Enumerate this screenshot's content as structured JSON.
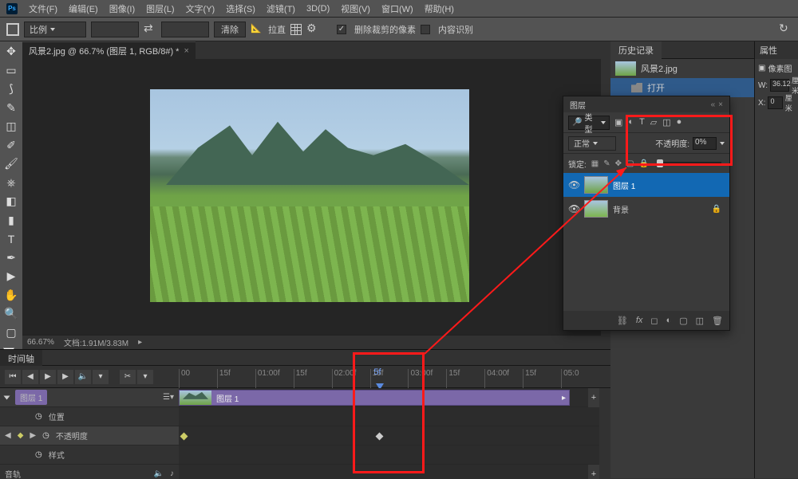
{
  "menubar": {
    "items": [
      "文件(F)",
      "编辑(E)",
      "图像(I)",
      "图层(L)",
      "文字(Y)",
      "选择(S)",
      "滤镜(T)",
      "3D(D)",
      "视图(V)",
      "窗口(W)",
      "帮助(H)"
    ]
  },
  "optbar": {
    "ratio_label": "比例",
    "clear": "清除",
    "straighten": "拉直",
    "delete_cropped": "删除裁剪的像素",
    "content_aware": "内容识别"
  },
  "doctab": {
    "title": "风景2.jpg @ 66.7% (图层 1, RGB/8#) *"
  },
  "zoom": {
    "percent": "66.67%",
    "docinfo": "文档:1.91M/3.83M"
  },
  "timeline": {
    "tab": "时间轴",
    "playhead": "5f",
    "ruler": [
      "00",
      "15f",
      "01:00f",
      "15f",
      "02:00f",
      "15f",
      "03:00f",
      "15f",
      "04:00f",
      "15f",
      "05:0"
    ],
    "layer_name": "图层 1",
    "clip_name": "图层 1",
    "tracks": {
      "position": "位置",
      "opacity": "不透明度",
      "style": "样式"
    },
    "audio": "音轨"
  },
  "history": {
    "tab": "历史记录",
    "file": "风景2.jpg",
    "open": "打开"
  },
  "layers": {
    "title": "图层",
    "kind": "类型",
    "blend": "正常",
    "opacity_label": "不透明度:",
    "opacity_value": "0%",
    "lock_label": "锁定:",
    "layer1": "图层 1",
    "background": "背景"
  },
  "properties": {
    "tab": "属性",
    "pixel_layer": "像素图",
    "w_label": "W:",
    "w_value": "36.12",
    "unit": "厘米",
    "x_label": "X:",
    "x_value": "0"
  }
}
